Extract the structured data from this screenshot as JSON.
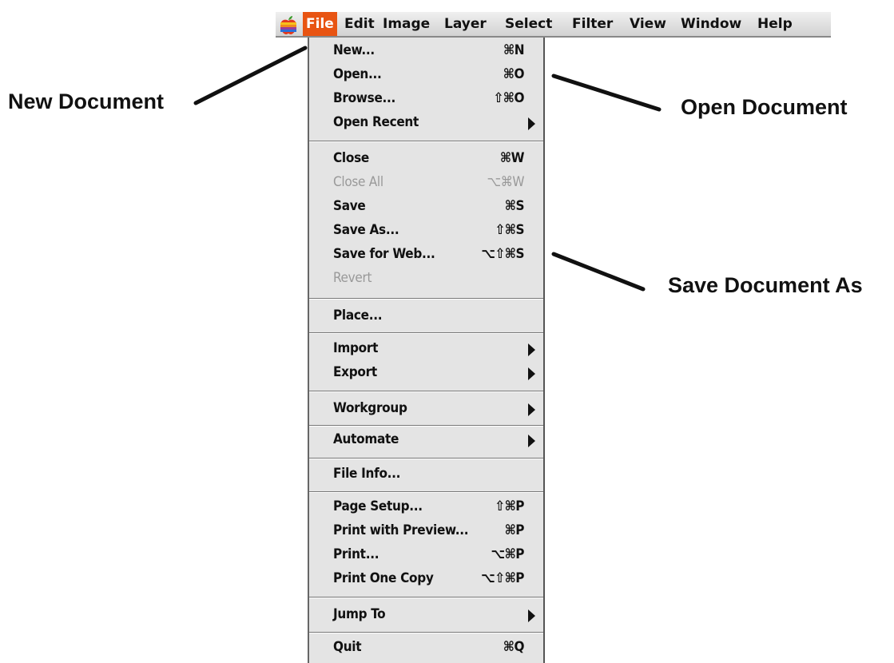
{
  "menubar": {
    "items": [
      {
        "label": "File",
        "active": true
      },
      {
        "label": "Edit"
      },
      {
        "label": "Image"
      },
      {
        "label": "Layer"
      },
      {
        "label": "Select"
      },
      {
        "label": "Filter"
      },
      {
        "label": "View"
      },
      {
        "label": "Window"
      },
      {
        "label": "Help"
      }
    ]
  },
  "file_menu": {
    "new": {
      "label": "New...",
      "shortcut": "⌘N"
    },
    "open": {
      "label": "Open...",
      "shortcut": "⌘O"
    },
    "browse": {
      "label": "Browse...",
      "shortcut": "⇧⌘O"
    },
    "open_recent": {
      "label": "Open Recent"
    },
    "close": {
      "label": "Close",
      "shortcut": "⌘W"
    },
    "close_all": {
      "label": "Close All",
      "shortcut": "⌥⌘W",
      "disabled": true
    },
    "save": {
      "label": "Save",
      "shortcut": "⌘S"
    },
    "save_as": {
      "label": "Save As...",
      "shortcut": "⇧⌘S"
    },
    "save_for_web": {
      "label": "Save for Web...",
      "shortcut": "⌥⇧⌘S"
    },
    "revert": {
      "label": "Revert",
      "disabled": true
    },
    "place": {
      "label": "Place..."
    },
    "import": {
      "label": "Import"
    },
    "export": {
      "label": "Export"
    },
    "workgroup": {
      "label": "Workgroup"
    },
    "automate": {
      "label": "Automate"
    },
    "file_info": {
      "label": "File Info..."
    },
    "page_setup": {
      "label": "Page Setup...",
      "shortcut": "⇧⌘P"
    },
    "print_with_preview": {
      "label": "Print with Preview...",
      "shortcut": "⌘P"
    },
    "print": {
      "label": "Print...",
      "shortcut": "⌥⌘P"
    },
    "print_one_copy": {
      "label": "Print One Copy",
      "shortcut": "⌥⇧⌘P"
    },
    "jump_to": {
      "label": "Jump To"
    },
    "quit": {
      "label": "Quit",
      "shortcut": "⌘Q"
    }
  },
  "callouts": {
    "new_document": "New Document",
    "open_document": "Open Document",
    "save_document_as": "Save Document As"
  },
  "colors": {
    "active_menu": "#e85412",
    "menu_background": "#e4e4e4"
  },
  "icons": {
    "apple": "apple-logo-icon",
    "submenu": "submenu-arrow-icon"
  }
}
